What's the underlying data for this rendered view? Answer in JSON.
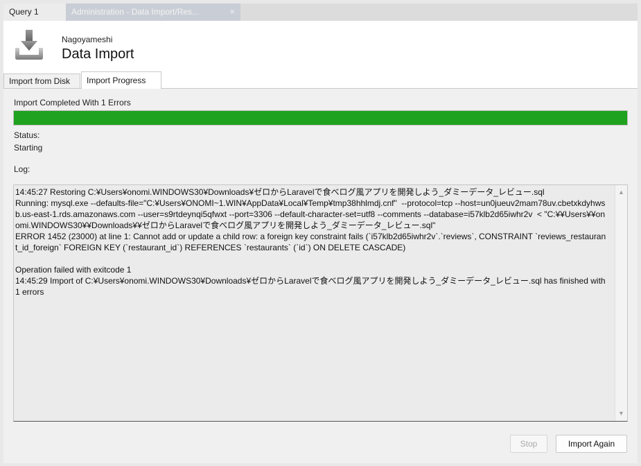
{
  "tabs": [
    {
      "label": "Query 1"
    },
    {
      "label": "Administration - Data Import/Res...",
      "close": "×"
    }
  ],
  "header": {
    "subtitle": "Nagoyameshi",
    "title": "Data Import",
    "icon": "import-download-icon"
  },
  "subtabs": [
    {
      "label": "Import from Disk"
    },
    {
      "label": "Import Progress"
    }
  ],
  "progress": {
    "heading": "Import Completed With 1 Errors",
    "fill_fraction": 1.0,
    "bar_color": "#1fa21f"
  },
  "status": {
    "label": "Status:",
    "value": "Starting"
  },
  "log": {
    "label": "Log:",
    "text": "14:45:27 Restoring C:¥Users¥onomi.WINDOWS30¥Downloads¥ゼロからLaravelで食べログ風アプリを開発しよう_ダミーデータ_レビュー.sql\nRunning: mysql.exe --defaults-file=\"C:¥Users¥ONOMI~1.WIN¥AppData¥Local¥Temp¥tmp38hhlmdj.cnf\"  --protocol=tcp --host=un0jueuv2mam78uv.cbetxkdyhwsb.us-east-1.rds.amazonaws.com --user=s9rtdeynqi5qfwxt --port=3306 --default-character-set=utf8 --comments --database=i57klb2d65iwhr2v  < \"C:¥¥Users¥¥onomi.WINDOWS30¥¥Downloads¥¥ゼロからLaravelで食べログ風アプリを開発しよう_ダミーデータ_レビュー.sql\"\nERROR 1452 (23000) at line 1: Cannot add or update a child row: a foreign key constraint fails (`i57klb2d65iwhr2v`.`reviews`, CONSTRAINT `reviews_restaurant_id_foreign` FOREIGN KEY (`restaurant_id`) REFERENCES `restaurants` (`id`) ON DELETE CASCADE)\n\nOperation failed with exitcode 1\n14:45:29 Import of C:¥Users¥onomi.WINDOWS30¥Downloads¥ゼロからLaravelで食べログ風アプリを開発しよう_ダミーデータ_レビュー.sql has finished with 1 errors"
  },
  "buttons": {
    "stop": "Stop",
    "import_again": "Import Again"
  }
}
